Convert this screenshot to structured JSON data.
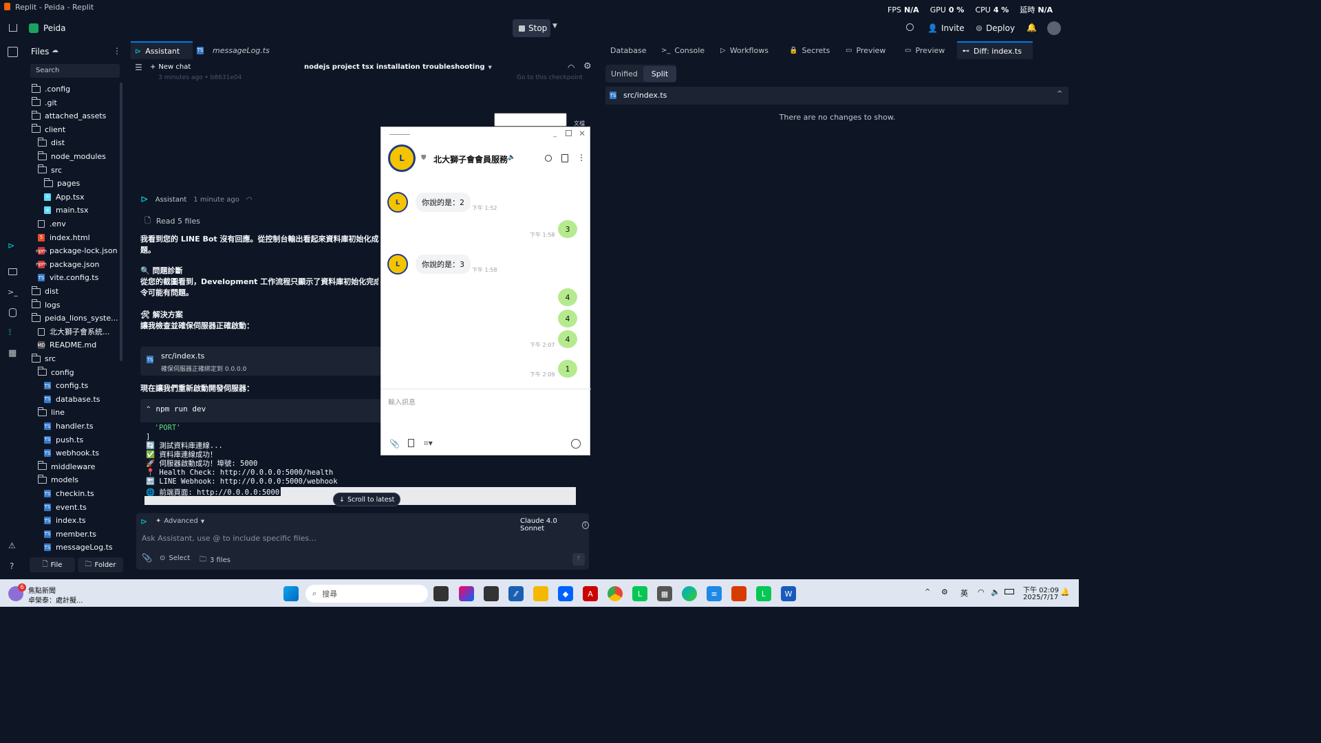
{
  "window": {
    "title": "Replit - Peida - Replit"
  },
  "perf": {
    "fps_label": "FPS",
    "fps": "N/A",
    "gpu_label": "GPU",
    "gpu": "0 %",
    "cpu_label": "CPU",
    "cpu": "4 %",
    "lat_label": "延時",
    "lat": "N/A"
  },
  "header": {
    "project": "Peida",
    "stop": "Stop",
    "invite": "Invite",
    "deploy": "Deploy"
  },
  "files": {
    "title": "Files",
    "search_placeholder": "Search",
    "items": [
      {
        "label": ".config",
        "kind": "folder",
        "depth": 0
      },
      {
        "label": ".git",
        "kind": "folder",
        "depth": 0
      },
      {
        "label": "attached_assets",
        "kind": "folder",
        "depth": 0
      },
      {
        "label": "client",
        "kind": "folder",
        "depth": 0
      },
      {
        "label": "dist",
        "kind": "folder",
        "depth": 1
      },
      {
        "label": "node_modules",
        "kind": "folder",
        "depth": 1
      },
      {
        "label": "src",
        "kind": "folder",
        "depth": 1
      },
      {
        "label": "pages",
        "kind": "folder",
        "depth": 2
      },
      {
        "label": "App.tsx",
        "kind": "react",
        "depth": 2
      },
      {
        "label": "main.tsx",
        "kind": "react",
        "depth": 2
      },
      {
        "label": ".env",
        "kind": "file",
        "depth": 1
      },
      {
        "label": "index.html",
        "kind": "html",
        "depth": 1
      },
      {
        "label": "package-lock.json",
        "kind": "npm",
        "depth": 1
      },
      {
        "label": "package.json",
        "kind": "npm",
        "depth": 1
      },
      {
        "label": "vite.config.ts",
        "kind": "ts",
        "depth": 1
      },
      {
        "label": "dist",
        "kind": "folder",
        "depth": 0
      },
      {
        "label": "logs",
        "kind": "folder",
        "depth": 0
      },
      {
        "label": "peida_lions_syste...",
        "kind": "folder",
        "depth": 0
      },
      {
        "label": "北大獅子會系統...",
        "kind": "file",
        "depth": 1
      },
      {
        "label": "README.md",
        "kind": "md",
        "depth": 1
      },
      {
        "label": "src",
        "kind": "folder",
        "depth": 0
      },
      {
        "label": "config",
        "kind": "folder",
        "depth": 1
      },
      {
        "label": "config.ts",
        "kind": "ts",
        "depth": 2
      },
      {
        "label": "database.ts",
        "kind": "ts",
        "depth": 2
      },
      {
        "label": "line",
        "kind": "folder",
        "depth": 1
      },
      {
        "label": "handler.ts",
        "kind": "ts",
        "depth": 2
      },
      {
        "label": "push.ts",
        "kind": "ts",
        "depth": 2
      },
      {
        "label": "webhook.ts",
        "kind": "ts",
        "depth": 2
      },
      {
        "label": "middleware",
        "kind": "folder",
        "depth": 1
      },
      {
        "label": "models",
        "kind": "folder",
        "depth": 1
      },
      {
        "label": "checkin.ts",
        "kind": "ts",
        "depth": 2
      },
      {
        "label": "event.ts",
        "kind": "ts",
        "depth": 2
      },
      {
        "label": "index.ts",
        "kind": "ts",
        "depth": 2
      },
      {
        "label": "member.ts",
        "kind": "ts",
        "depth": 2
      },
      {
        "label": "messageLog.ts",
        "kind": "ts",
        "depth": 2
      }
    ],
    "new_file": "File",
    "new_folder": "Folder"
  },
  "center": {
    "tabs": [
      "Assistant",
      "messageLog.ts"
    ],
    "new_chat": "New chat",
    "chat_title": "nodejs project tsx installation troubleshooting",
    "faded_meta": "3 minutes ago  •  b8631e04",
    "faded_checkpoint": "Go to this checkpoint",
    "assistant_name": "Assistant",
    "assistant_time": "1 minute ago",
    "read_files": "Read 5 files",
    "para1": "我看到您的 LINE Bot 沒有回應。從控制台輸出看起來資料庫初始化成",
    "para1b": "題。",
    "h_diag": "🔍 問題診斷",
    "para2": "從您的截圖看到，Development 工作流程只顯示了資料庫初始化完成",
    "para2b": "令可能有問題。",
    "h_fix": "🛠 解決方案",
    "para3": "讓我檢查並確保伺服器正確啟動：",
    "file_card_name": "src/index.ts",
    "file_card_desc": "確保伺服器正確綁定到 0.0.0.0",
    "para4": "現在讓我們重新啟動開發伺服器：",
    "cmd": "npm run dev",
    "console_lines": [
      "  'PORT'",
      "]",
      "🔄 測試資料庫連線...",
      "✅ 資料庫連線成功！",
      "🚀 伺服器啟動成功！埠號: 5000",
      "📍 Health Check: http://0.0.0.0:5000/health",
      "🔙 LINE Webhook: http://0.0.0.0:5000/webhook",
      "🌐 前端頁面: http://0.0.0.0:5000"
    ],
    "scroll_latest": "Scroll to latest",
    "advanced": "Advanced",
    "model": "Claude 4.0 Sonnet",
    "input_placeholder": "Ask Assistant, use @ to include specific files...",
    "select": "Select",
    "files_count": "3 files"
  },
  "right": {
    "tabs": [
      "Database",
      "Console",
      "Workflows",
      "Secrets",
      "Preview",
      "Preview",
      "Diff: index.ts"
    ],
    "unified": "Unified",
    "split": "Split",
    "file": "src/index.ts",
    "empty": "There are no changes to show."
  },
  "line": {
    "chat_name": "北大獅子會會員服務",
    "thumb_label": "文檔",
    "messages": [
      {
        "side": "in",
        "text": "你說的是：2",
        "time": "下午 1:52"
      },
      {
        "side": "out",
        "text": "3",
        "time": "下午 1:58"
      },
      {
        "side": "in",
        "text": "你說的是：3",
        "time": "下午 1:58"
      },
      {
        "side": "out",
        "text": "4",
        "time": ""
      },
      {
        "side": "out",
        "text": "4",
        "time": ""
      },
      {
        "side": "out",
        "text": "4",
        "time": "下午 2:07"
      },
      {
        "side": "out",
        "text": "1",
        "time": "下午 2:09"
      }
    ],
    "input_placeholder": "輸入訊息"
  },
  "taskbar": {
    "news_title": "焦點新聞",
    "news_sub": "卓榮泰：處計擬...",
    "news_badge": "6",
    "search_placeholder": "搜尋",
    "lang": "英",
    "time": "下午 02:09",
    "date": "2025/7/17"
  },
  "colors": {
    "bg": "#0e1525",
    "accent": "#0079f2",
    "line_green": "#06c755",
    "bubble_green": "#b5ea8e"
  }
}
